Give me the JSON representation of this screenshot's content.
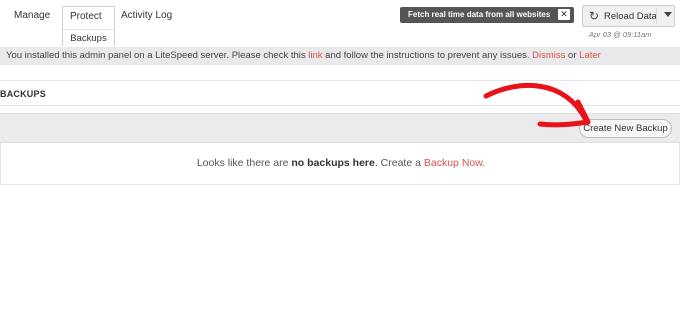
{
  "nav": {
    "manage": "Manage",
    "protect": "Protect",
    "protect_sub": "Backups",
    "activity": "Activity Log"
  },
  "header": {
    "fetch_tip": "Fetch real time data from all websites",
    "fetch_close": "✕",
    "reload_label": "Reload Data",
    "reload_icon": "refresh-icon",
    "timestamp": "Apr 03 @ 09:11am"
  },
  "notice": {
    "text_before": "You installed this admin panel on a LiteSpeed server. Please check this ",
    "link": "link",
    "text_middle": " and follow the instructions to prevent any issues. ",
    "dismiss": "Dismiss",
    "or": " or ",
    "later": "Later"
  },
  "backups": {
    "title": "BACKUPS",
    "create_button": "Create New Backup",
    "empty_before": "Looks like there are ",
    "empty_bold": "no backups here",
    "empty_middle": ". Create a ",
    "empty_link": "Backup Now",
    "empty_after": "."
  },
  "colors": {
    "link": "#d9534f",
    "annotation_arrow": "#e8121a",
    "notice_bg": "#e9e9e9"
  }
}
